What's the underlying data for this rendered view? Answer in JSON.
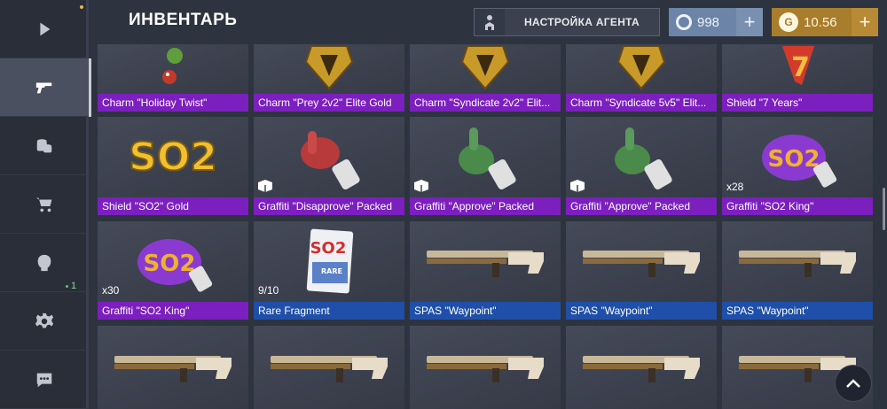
{
  "header": {
    "title": "ИНВЕНТАРЬ",
    "agent_button": "НАСТРОЙКА АГЕНТА",
    "silver": "998",
    "gold": "10.56",
    "gold_symbol": "G",
    "plus": "+"
  },
  "sidebar": {
    "items": [
      {
        "icon": "play-icon"
      },
      {
        "icon": "pistol-icon"
      },
      {
        "icon": "coins-icon"
      },
      {
        "icon": "cart-icon"
      },
      {
        "icon": "clan-icon"
      },
      {
        "icon": "gear-icon"
      },
      {
        "icon": "chat-icon"
      }
    ],
    "clan_count": "1"
  },
  "items": {
    "row1": [
      {
        "name": "Charm \"Holiday Twist\""
      },
      {
        "name": "Charm \"Prey 2v2\" Elite Gold"
      },
      {
        "name": "Charm \"Syndicate 2v2\" Elit..."
      },
      {
        "name": "Charm \"Syndicate 5v5\" Elit..."
      },
      {
        "name": "Shield \"7 Years\""
      }
    ],
    "row2": [
      {
        "name": "Shield \"SO2\" Gold"
      },
      {
        "name": "Graffiti \"Disapprove\" Packed"
      },
      {
        "name": "Graffiti \"Approve\" Packed"
      },
      {
        "name": "Graffiti \"Approve\" Packed"
      },
      {
        "name": "Graffiti \"SO2 King\"",
        "qty": "x28"
      }
    ],
    "row3": [
      {
        "name": "Graffiti \"SO2 King\"",
        "qty": "x30"
      },
      {
        "name": "Rare Fragment",
        "qty": "9/10"
      },
      {
        "name": "SPAS \"Waypoint\""
      },
      {
        "name": "SPAS \"Waypoint\""
      },
      {
        "name": "SPAS \"Waypoint\""
      }
    ]
  },
  "art_text": {
    "so2": "SO2",
    "rare": "RARE",
    "seven": "7"
  },
  "colors": {
    "purple": "#7c1fbf",
    "blue": "#1f4fa8",
    "gold": "#a87d2c",
    "silver": "#6b84a8"
  }
}
